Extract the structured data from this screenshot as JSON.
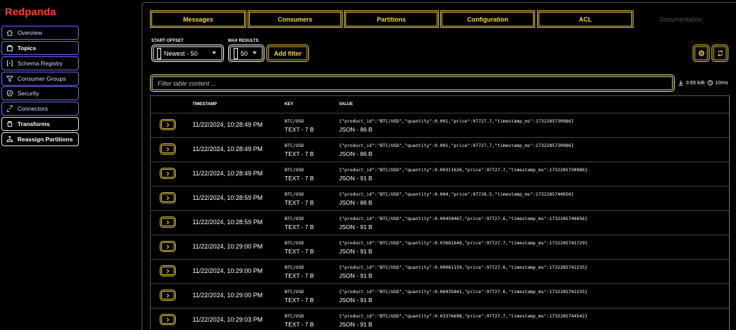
{
  "brand": "Redpanda",
  "sidebar": {
    "items": [
      {
        "label": "Overview",
        "icon": "home-icon"
      },
      {
        "label": "Topics",
        "icon": "topics-icon"
      },
      {
        "label": "Schema Registry",
        "icon": "schema-icon"
      },
      {
        "label": "Consumer Groups",
        "icon": "funnel-icon"
      },
      {
        "label": "Security",
        "icon": "shield-icon"
      },
      {
        "label": "Connectors",
        "icon": "link-icon"
      },
      {
        "label": "Transforms",
        "icon": "transform-icon"
      },
      {
        "label": "Reassign Partitions",
        "icon": "reassign-icon"
      }
    ]
  },
  "tabs": [
    "Messages",
    "Consumers",
    "Partitions",
    "Configuration",
    "ACL",
    "Documentation"
  ],
  "controls": {
    "start_offset_label": "START OFFSET",
    "start_offset_value": "Newest - 50",
    "max_results_label": "MAX RESULTS",
    "max_results_value": "50",
    "add_filter": "Add filter",
    "filter_placeholder": "Filter table content ...",
    "size": "3.65 kiB",
    "duration": "10ms"
  },
  "table": {
    "headers": {
      "timestamp": "TIMESTAMP",
      "key": "KEY",
      "value": "VALUE"
    },
    "rows": [
      {
        "timestamp": "11/22/2024, 10:28:49 PM",
        "key": "BTC/USD",
        "key_type": "TEXT - 7 B",
        "value": "{\"product_id\":\"BTC/USD\",\"quantity\":0.001,\"price\":97727.7,\"timestamp_ms\":1732285730986}",
        "value_type": "JSON - 86 B"
      },
      {
        "timestamp": "11/22/2024, 10:28:49 PM",
        "key": "BTC/USD",
        "key_type": "TEXT - 7 B",
        "value": "{\"product_id\":\"BTC/USD\",\"quantity\":0.001,\"price\":97727.7,\"timestamp_ms\":1732285730986}",
        "value_type": "JSON - 86 B"
      },
      {
        "timestamp": "11/22/2024, 10:28:49 PM",
        "key": "BTC/USD",
        "key_type": "TEXT - 7 B",
        "value": "{\"product_id\":\"BTC/USD\",\"quantity\":0.00311626,\"price\":97727.7,\"timestamp_ms\":1732285730986}",
        "value_type": "JSON - 91 B"
      },
      {
        "timestamp": "11/22/2024, 10:28:59 PM",
        "key": "BTC/USD",
        "key_type": "TEXT - 7 B",
        "value": "{\"product_id\":\"BTC/USD\",\"quantity\":0.004,\"price\":97728.5,\"timestamp_ms\":1732285740656}",
        "value_type": "JSON - 86 B"
      },
      {
        "timestamp": "11/22/2024, 10:28:59 PM",
        "key": "BTC/USD",
        "key_type": "TEXT - 7 B",
        "value": "{\"product_id\":\"BTC/USD\",\"quantity\":0.00450467,\"price\":97727.6,\"timestamp_ms\":1732285740656}",
        "value_type": "JSON - 91 B"
      },
      {
        "timestamp": "11/22/2024, 10:29:00 PM",
        "key": "BTC/USD",
        "key_type": "TEXT - 7 B",
        "value": "{\"product_id\":\"BTC/USD\",\"quantity\":0.03681649,\"price\":97727.7,\"timestamp_ms\":1732285741729}",
        "value_type": "JSON - 91 B"
      },
      {
        "timestamp": "11/22/2024, 10:29:00 PM",
        "key": "BTC/USD",
        "key_type": "TEXT - 7 B",
        "value": "{\"product_id\":\"BTC/USD\",\"quantity\":0.00061159,\"price\":97727.6,\"timestamp_ms\":1732285742235}",
        "value_type": "JSON - 91 B"
      },
      {
        "timestamp": "11/22/2024, 10:29:00 PM",
        "key": "BTC/USD",
        "key_type": "TEXT - 7 B",
        "value": "{\"product_id\":\"BTC/USD\",\"quantity\":0.06935841,\"price\":97727.6,\"timestamp_ms\":1732285742235}",
        "value_type": "JSON - 91 B"
      },
      {
        "timestamp": "11/22/2024, 10:29:03 PM",
        "key": "BTC/USD",
        "key_type": "TEXT - 7 B",
        "value": "{\"product_id\":\"BTC/USD\",\"quantity\":0.03376698,\"price\":97727.7,\"timestamp_ms\":1732285744542}",
        "value_type": "JSON - 91 B"
      }
    ]
  },
  "colors": {
    "brand": "#ff3b3b",
    "accent": "#e6c84a",
    "nav_border": "#6b6bff"
  }
}
